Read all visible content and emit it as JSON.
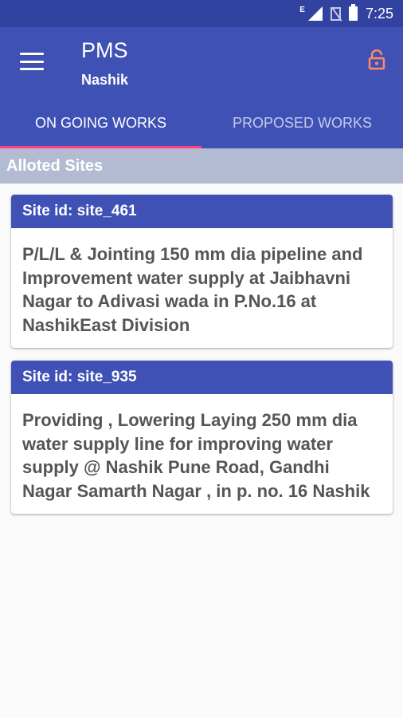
{
  "status_bar": {
    "network_type": "E",
    "time": "7:25",
    "icons": [
      "signal-icon",
      "no-sim-icon",
      "battery-icon"
    ]
  },
  "app_bar": {
    "title": "PMS",
    "subtitle": "Nashik",
    "menu_icon": "hamburger-menu-icon",
    "lock_icon": "lock-open-icon",
    "lock_icon_color": "#ff8a65"
  },
  "tabs": [
    {
      "label": "ON GOING WORKS",
      "active": true
    },
    {
      "label": "PROPOSED WORKS",
      "active": false
    }
  ],
  "section_title": "Alloted Sites",
  "sites": [
    {
      "id_label": "Site id: site_461",
      "description": "P/L/L & Jointing 150 mm dia pipeline and Improvement water supply at Jaibhavni Nagar to Adivasi wada in P.No.16 at NashikEast Division"
    },
    {
      "id_label": "Site id: site_935",
      "description": "Providing , Lowering Laying  250 mm dia water supply line for  improving water supply @ Nashik Pune Road, Gandhi Nagar Samarth Nagar , in p. no. 16 Nashik"
    }
  ],
  "colors": {
    "primary": "#3f51b5",
    "primary_dark": "#3142a0",
    "accent": "#ff4081",
    "section_header_bg": "#b3bbd3"
  }
}
